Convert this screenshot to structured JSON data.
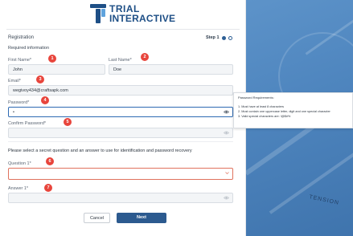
{
  "brand": {
    "logo_line1": "TRIAL",
    "logo_line2": "INTERACTIVE"
  },
  "header": {
    "title": "Registration",
    "step_label": "Step 1"
  },
  "form": {
    "required_info": "Required information",
    "first_name": {
      "label": "First Name*",
      "value": "John",
      "badge": "1"
    },
    "last_name": {
      "label": "Last Name*",
      "value": "Doe",
      "badge": "2"
    },
    "email": {
      "label": "Email*",
      "value": "wegivoy434@craftsapk.com",
      "badge": "3"
    },
    "password": {
      "label": "Password*",
      "value": "•",
      "badge": "4"
    },
    "confirm_password": {
      "label": "Confirm Password*",
      "value": "",
      "badge": "5"
    },
    "secret_question_prompt": "Please select a secret question and an answer to use for identification and password recovery",
    "question1": {
      "label": "Question 1*",
      "value": "",
      "badge": "6"
    },
    "answer1": {
      "label": "Answer 1*",
      "value": "",
      "badge": "7"
    }
  },
  "buttons": {
    "cancel": "Cancel",
    "next": "Next"
  },
  "password_tooltip": {
    "title": "Password Requirements:",
    "items": [
      "1. Must have at least 8 characters",
      "2. Must contain one uppercase letter, digit and one special character",
      "3. Valid special characters are: !@$#%"
    ]
  },
  "background": {
    "stamp_text": "TENSION"
  },
  "colors": {
    "brand": "#1e4f86",
    "primary_button": "#2c5a8f",
    "badge": "#e8453c",
    "error_border": "#e0725e",
    "background_blue": "#4f86bf"
  }
}
